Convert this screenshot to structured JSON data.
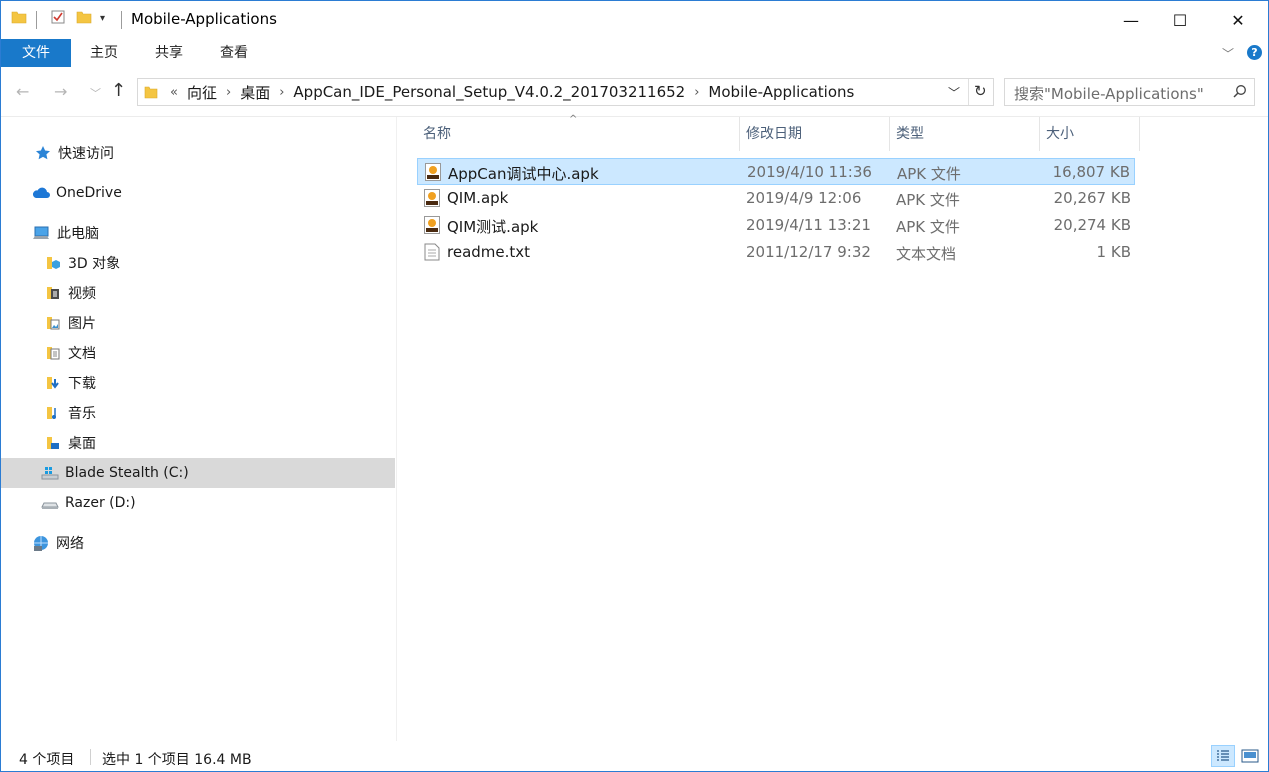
{
  "window": {
    "title": "Mobile-Applications",
    "minimize": "—",
    "maximize": "☐",
    "close": "✕"
  },
  "ribbon": {
    "tabs": [
      "文件",
      "主页",
      "共享",
      "查看"
    ]
  },
  "address": {
    "overflow": "«",
    "crumbs": [
      "向征",
      "桌面",
      "AppCan_IDE_Personal_Setup_V4.0.2_201703211652",
      "Mobile-Applications"
    ]
  },
  "search": {
    "placeholder": "搜索\"Mobile-Applications\""
  },
  "nav": {
    "items": [
      {
        "label": "快速访问",
        "icon": "star-icon"
      },
      {
        "label": "OneDrive",
        "icon": "cloud-icon"
      },
      {
        "label": "此电脑",
        "icon": "computer-icon"
      },
      {
        "label": "3D 对象",
        "icon": "folder-3d-icon"
      },
      {
        "label": "视频",
        "icon": "folder-video-icon"
      },
      {
        "label": "图片",
        "icon": "folder-pictures-icon"
      },
      {
        "label": "文档",
        "icon": "folder-documents-icon"
      },
      {
        "label": "下载",
        "icon": "folder-downloads-icon"
      },
      {
        "label": "音乐",
        "icon": "folder-music-icon"
      },
      {
        "label": "桌面",
        "icon": "folder-desktop-icon"
      },
      {
        "label": "Blade Stealth (C:)",
        "icon": "windows-drive-icon"
      },
      {
        "label": "Razer (D:)",
        "icon": "drive-icon"
      },
      {
        "label": "网络",
        "icon": "network-icon"
      }
    ]
  },
  "columns": [
    "名称",
    "修改日期",
    "类型",
    "大小"
  ],
  "files": [
    {
      "name": "AppCan调试中心.apk",
      "date": "2019/4/10 11:36",
      "type": "APK 文件",
      "size": "16,807 KB",
      "icon": "apk-icon"
    },
    {
      "name": "QIM.apk",
      "date": "2019/4/9 12:06",
      "type": "APK 文件",
      "size": "20,267 KB",
      "icon": "apk-icon"
    },
    {
      "name": "QIM测试.apk",
      "date": "2019/4/11 13:21",
      "type": "APK 文件",
      "size": "20,274 KB",
      "icon": "apk-icon"
    },
    {
      "name": "readme.txt",
      "date": "2011/12/17 9:32",
      "type": "文本文档",
      "size": "1 KB",
      "icon": "text-file-icon"
    }
  ],
  "status": {
    "count": "4 个项目",
    "selection": "选中 1 个项目  16.4 MB"
  },
  "colors": {
    "accent": "#1979ca",
    "selection": "#cce8ff",
    "folder": "#f4c542"
  }
}
